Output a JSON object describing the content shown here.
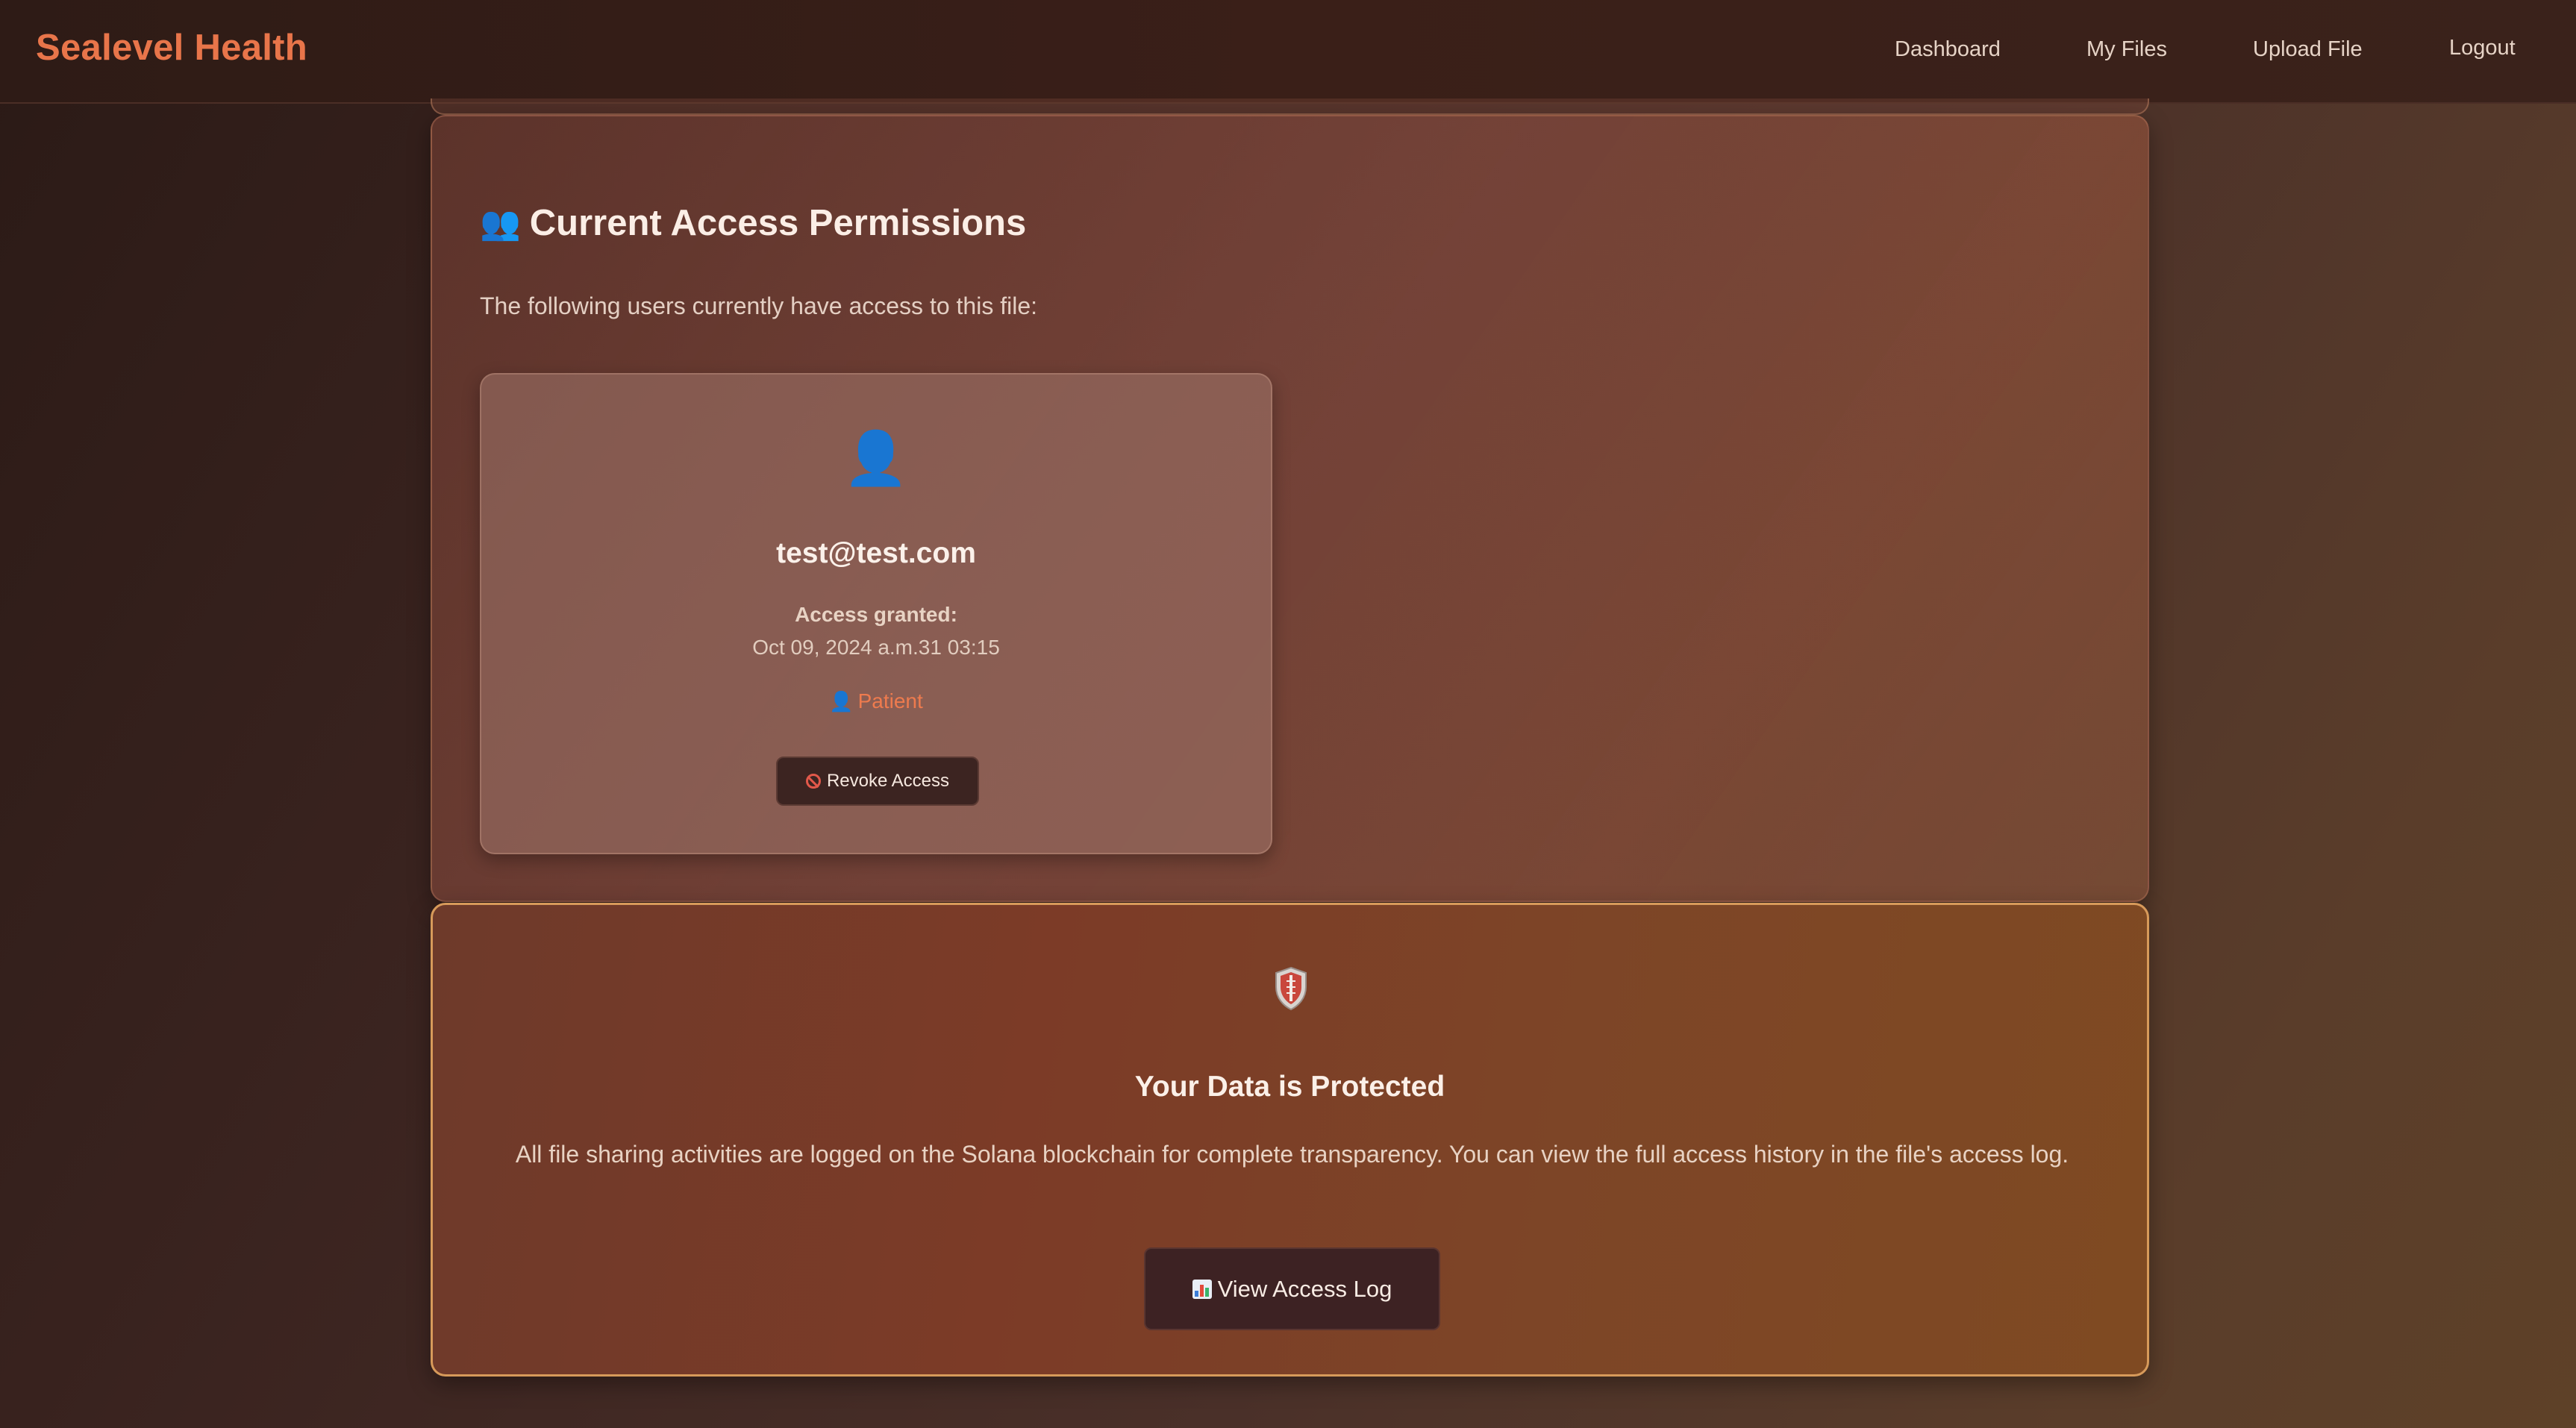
{
  "nav": {
    "brand": "Sealevel Health",
    "links": [
      "Dashboard",
      "My Files",
      "Upload File",
      "Logout"
    ]
  },
  "permissions": {
    "title": "Current Access Permissions",
    "title_icon": "people-icon",
    "description": "The following users currently have access to this file:",
    "users": [
      {
        "avatar_icon": "user-silhouette-icon",
        "email": "test@test.com",
        "access_label": "Access granted:",
        "access_date": "Oct 09, 2024 a.m.31 03:15",
        "role_icon": "user-silhouette-icon",
        "role": "Patient",
        "revoke_icon": "prohibited-icon",
        "revoke_label": "Revoke Access"
      }
    ]
  },
  "protection": {
    "icon": "shield-icon",
    "title": "Your Data is Protected",
    "description": "All file sharing activities are logged on the Solana blockchain for complete transparency. You can view the full access history in the file's access log.",
    "button_icon": "bar-chart-icon",
    "button_label": "View Access Log"
  },
  "colors": {
    "brand": "#e8754a",
    "role": "#ee7b4e",
    "protect_border": "#d79a5a"
  }
}
